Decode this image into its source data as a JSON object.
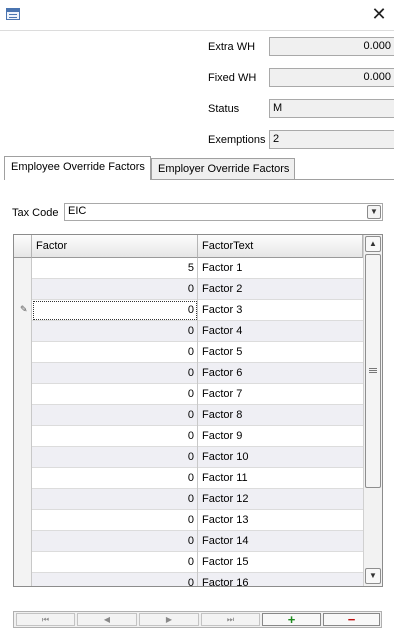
{
  "titlebar": {
    "close_glyph": "✕"
  },
  "fields": {
    "extra_wh": {
      "label": "Extra WH",
      "value": "0.000"
    },
    "fixed_wh": {
      "label": "Fixed WH",
      "value": "0.000"
    },
    "status": {
      "label": "Status",
      "value": "M"
    },
    "exemptions": {
      "label": "Exemptions",
      "value": "2"
    }
  },
  "tabs": [
    {
      "label": "Employee Override Factors",
      "active": true
    },
    {
      "label": "Employer Override Factors",
      "active": false
    }
  ],
  "tax_code": {
    "label": "Tax Code",
    "value": "EIC"
  },
  "grid": {
    "columns": [
      "Factor",
      "FactorText"
    ],
    "rows": [
      {
        "factor": "5",
        "text": "Factor 1"
      },
      {
        "factor": "0",
        "text": "Factor 2"
      },
      {
        "factor": "0",
        "text": "Factor 3"
      },
      {
        "factor": "0",
        "text": "Factor 4"
      },
      {
        "factor": "0",
        "text": "Factor 5"
      },
      {
        "factor": "0",
        "text": "Factor 6"
      },
      {
        "factor": "0",
        "text": "Factor 7"
      },
      {
        "factor": "0",
        "text": "Factor 8"
      },
      {
        "factor": "0",
        "text": "Factor 9"
      },
      {
        "factor": "0",
        "text": "Factor 10"
      },
      {
        "factor": "0",
        "text": "Factor 11"
      },
      {
        "factor": "0",
        "text": "Factor 12"
      },
      {
        "factor": "0",
        "text": "Factor 13"
      },
      {
        "factor": "0",
        "text": "Factor 14"
      },
      {
        "factor": "0",
        "text": "Factor 15"
      },
      {
        "factor": "0",
        "text": "Factor 16"
      }
    ]
  },
  "navigator": {
    "first_glyph": "⏮",
    "prev_glyph": "◀",
    "next_glyph": "▶",
    "last_glyph": "⏭",
    "add_glyph": "+",
    "delete_glyph": "−"
  }
}
